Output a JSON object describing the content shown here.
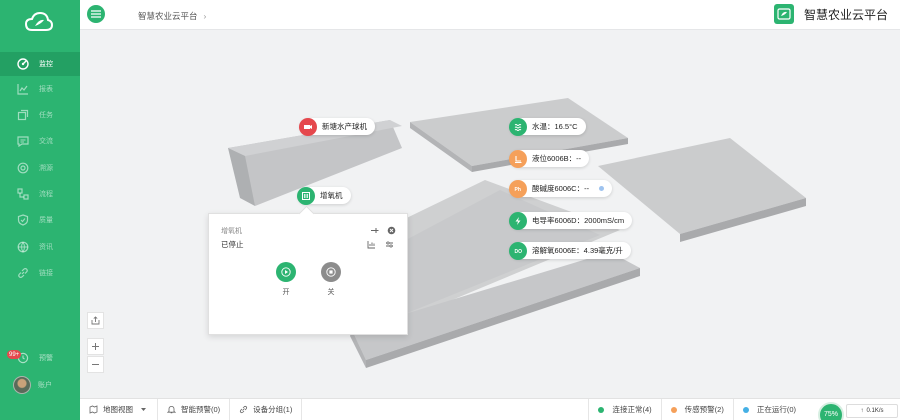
{
  "app": {
    "title": "智慧农业云平台",
    "breadcrumb": "智慧农业云平台",
    "breadcrumb_sep": "›"
  },
  "sidebar": {
    "items": [
      {
        "id": "monitor",
        "label": "监控",
        "icon": "dashboard-icon",
        "active": true
      },
      {
        "id": "report",
        "label": "报表",
        "icon": "chart-icon",
        "active": false
      },
      {
        "id": "task",
        "label": "任务",
        "icon": "task-icon",
        "active": false
      },
      {
        "id": "chat",
        "label": "交流",
        "icon": "chat-icon",
        "active": false
      },
      {
        "id": "track",
        "label": "溯源",
        "icon": "trace-icon",
        "active": false
      },
      {
        "id": "process",
        "label": "流程",
        "icon": "process-icon",
        "active": false
      },
      {
        "id": "quality",
        "label": "质量",
        "icon": "shield-icon",
        "active": false
      },
      {
        "id": "news",
        "label": "资讯",
        "icon": "globe-icon",
        "active": false
      },
      {
        "id": "link",
        "label": "链接",
        "icon": "link-icon",
        "active": false
      }
    ],
    "alarm_label": "预警",
    "alarm_badge": "99+",
    "account_label": "账户"
  },
  "map": {
    "tags": [
      {
        "id": "camera",
        "text": "新塘水产球机",
        "color": "#e5484d",
        "icon": "camera-icon"
      },
      {
        "id": "aerator",
        "text": "增氧机",
        "color": "#2cb471",
        "icon": "aerator-icon"
      },
      {
        "id": "water_temp",
        "text": "水温：16.5°C",
        "color": "#2cb471",
        "icon": "thermometer-icon"
      },
      {
        "id": "level",
        "text": "液位6006B：--",
        "color": "#f5a05a",
        "icon": "level-icon"
      },
      {
        "id": "ph",
        "text": "酸碱度6006C：--",
        "color": "#f5a05a",
        "icon": "ph-icon"
      },
      {
        "id": "conductivity",
        "text": "电导率6006D：2000mS/cm",
        "color": "#2cb471",
        "icon": "lightning-icon"
      },
      {
        "id": "oxygen",
        "text": "溶解氧6006E：4.39毫克/升",
        "color": "#2cb471",
        "icon": "oxygen-icon"
      }
    ],
    "popup": {
      "title": "增氧机",
      "status": "已停止",
      "on_label": "开",
      "off_label": "关"
    }
  },
  "bottombar": {
    "map_view": "地图视图",
    "smart_alarm": "智能预警(0)",
    "device_group": "设备分组(1)",
    "statuses": [
      {
        "label": "连接正常(4)",
        "color": "#2cb471"
      },
      {
        "label": "传感预警(2)",
        "color": "#f5a05a"
      },
      {
        "label": "正在运行(0)",
        "color": "#45b0e5"
      }
    ],
    "gauge_value": "75%",
    "net_speed": "0.1K/s"
  }
}
